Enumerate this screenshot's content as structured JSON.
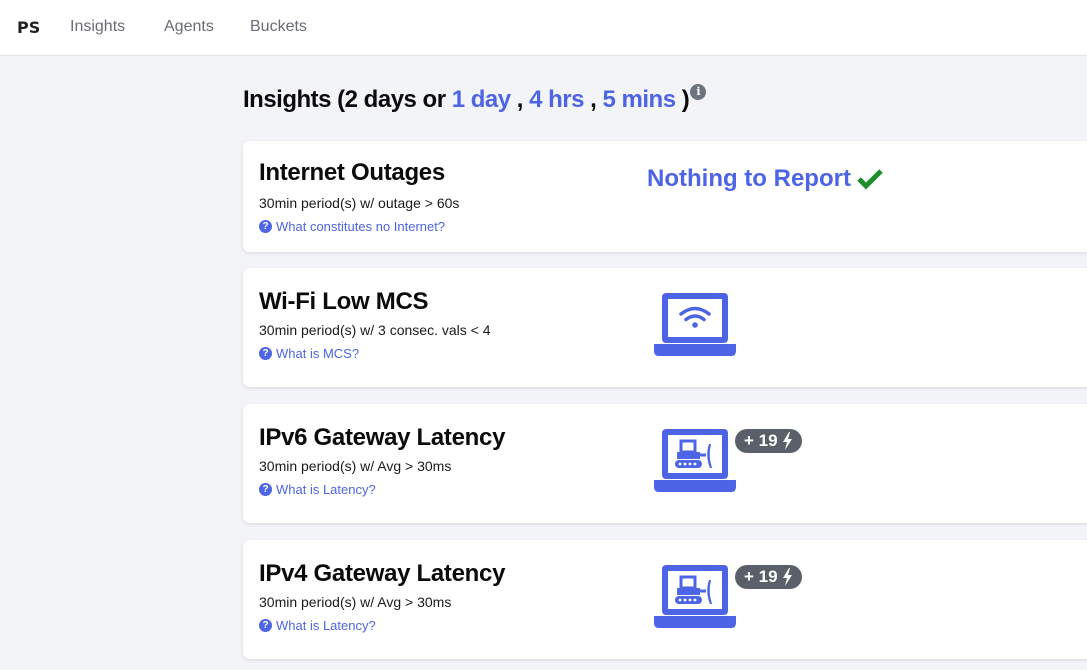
{
  "nav": {
    "brand": "PS",
    "items": [
      {
        "label": "Insights"
      },
      {
        "label": "Agents"
      },
      {
        "label": "Buckets"
      }
    ]
  },
  "page": {
    "title_prefix": "Insights (2 days or",
    "ranges": [
      "1 day",
      "4 hrs",
      "5 mins"
    ],
    "sep": ",",
    "close": ")"
  },
  "cards": [
    {
      "title": "Internet Outages",
      "subtitle": "30min period(s) w/ outage > 60s",
      "help": "What constitutes no Internet?",
      "status": "Nothing to Report"
    },
    {
      "title": "Wi-Fi Low MCS",
      "subtitle": "30min period(s) w/ 3 consec. vals < 4",
      "help": "What is MCS?",
      "icon": "wifi-laptop-icon"
    },
    {
      "title": "IPv6 Gateway Latency",
      "subtitle": "30min period(s) w/ Avg > 30ms",
      "help": "What is Latency?",
      "icon": "bulldozer-laptop-icon",
      "badge": "+ 19"
    },
    {
      "title": "IPv4 Gateway Latency",
      "subtitle": "30min period(s) w/ Avg > 30ms",
      "help": "What is Latency?",
      "icon": "bulldozer-laptop-icon",
      "badge": "+ 19"
    }
  ],
  "colors": {
    "accent": "#4d64e6",
    "success": "#1e8e2c",
    "badge": "#5b5f6a",
    "background": "#f3f4f7"
  }
}
